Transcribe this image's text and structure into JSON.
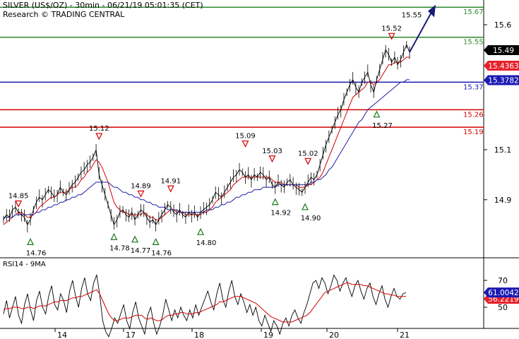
{
  "header": {
    "title": "SILVER (US$/OZ) - 30min - 06/21/19 05:01:35 (CET)",
    "subtitle": "Research © TRADING CENTRAL"
  },
  "rsi_header": "RSI14 - 9MA",
  "colors": {
    "price": "#000000",
    "ma_fast": "#d40000",
    "ma_slow": "#1f1fa8",
    "support_resistance_green": "#2e8b2e",
    "pivot_blue": "#1a1ab5",
    "red_line": "#d40000",
    "arrow": "#1a1a7a",
    "last_price_box": "#000000",
    "ma_box": "#e8202a",
    "pivot_box": "#1a1ab5",
    "rsi": "#000000",
    "rsi_ma": "#d40000"
  },
  "chart_data": [
    {
      "type": "line",
      "name": "price-panel",
      "x_tick_labels": [
        "14",
        "17",
        "18",
        "19",
        "20",
        "21"
      ],
      "y_ticks": [
        14.9,
        15.1,
        15.6
      ],
      "ylim": [
        14.8,
        15.7
      ],
      "horizontal_levels": [
        {
          "value": 15.67,
          "label": "15.67",
          "color": "green"
        },
        {
          "value": 15.55,
          "label": "15.55",
          "color": "green"
        },
        {
          "value": 15.37,
          "label": "15.37",
          "color": "blue"
        },
        {
          "value": 15.26,
          "label": "15.26",
          "color": "red"
        },
        {
          "value": 15.19,
          "label": "15.19",
          "color": "red"
        }
      ],
      "last_price": "15.49",
      "ma_value": "15.4363",
      "pivot_value": "15.3782",
      "highs": [
        {
          "label": "14.85",
          "value": 14.85,
          "bar": 5
        },
        {
          "label": "15.12",
          "value": 15.12,
          "bar": 32
        },
        {
          "label": "14.89",
          "value": 14.89,
          "bar": 46
        },
        {
          "label": "14.91",
          "value": 14.91,
          "bar": 56
        },
        {
          "label": "15.09",
          "value": 15.09,
          "bar": 81
        },
        {
          "label": "15.03",
          "value": 15.03,
          "bar": 90
        },
        {
          "label": "15.02",
          "value": 15.02,
          "bar": 102
        },
        {
          "label": "15.52",
          "value": 15.52,
          "bar": 130
        }
      ],
      "lows": [
        {
          "label": "14.76",
          "value": 14.76,
          "bar": 9
        },
        {
          "label": "14.78",
          "value": 14.78,
          "bar": 37
        },
        {
          "label": "14.77",
          "value": 14.77,
          "bar": 44
        },
        {
          "label": "14.76",
          "value": 14.76,
          "bar": 51
        },
        {
          "label": "14.80",
          "value": 14.8,
          "bar": 66
        },
        {
          "label": "14.92",
          "value": 14.92,
          "bar": 91
        },
        {
          "label": "14.90",
          "value": 14.9,
          "bar": 101
        },
        {
          "label": "15.27",
          "value": 15.27,
          "bar": 125
        }
      ],
      "last_high_label": "15.55",
      "series": [
        {
          "name": "Price",
          "values": [
            14.82,
            14.84,
            14.83,
            14.86,
            14.87,
            14.85,
            14.84,
            14.83,
            14.8,
            14.82,
            14.86,
            14.89,
            14.91,
            14.9,
            14.92,
            14.94,
            14.93,
            14.91,
            14.92,
            14.95,
            14.93,
            14.92,
            14.94,
            14.96,
            14.97,
            14.99,
            15.01,
            15.02,
            15.04,
            15.05,
            15.07,
            15.1,
            15.0,
            14.96,
            14.92,
            14.88,
            14.84,
            14.8,
            14.82,
            14.85,
            14.86,
            14.84,
            14.83,
            14.85,
            14.82,
            14.84,
            14.86,
            14.85,
            14.83,
            14.81,
            14.82,
            14.8,
            14.82,
            14.84,
            14.86,
            14.88,
            14.87,
            14.85,
            14.84,
            14.86,
            14.84,
            14.83,
            14.85,
            14.84,
            14.85,
            14.83,
            14.85,
            14.86,
            14.87,
            14.88,
            14.9,
            14.93,
            14.92,
            14.91,
            14.93,
            14.95,
            14.97,
            14.99,
            15.0,
            15.02,
            15.01,
            14.99,
            15.0,
            14.98,
            15.0,
            14.99,
            15.01,
            15.0,
            14.98,
            14.99,
            14.96,
            14.95,
            14.97,
            14.96,
            14.95,
            14.97,
            14.98,
            14.96,
            14.95,
            14.94,
            14.93,
            14.95,
            14.97,
            14.99,
            14.98,
            15.0,
            15.04,
            15.08,
            15.12,
            15.15,
            15.18,
            15.21,
            15.24,
            15.26,
            15.3,
            15.33,
            15.36,
            15.38,
            15.35,
            15.33,
            15.37,
            15.39,
            15.41,
            15.36,
            15.33,
            15.38,
            15.42,
            15.46,
            15.5,
            15.48,
            15.45,
            15.47,
            15.44,
            15.46,
            15.49,
            15.52,
            15.49
          ]
        },
        {
          "name": "MA fast",
          "values": [
            14.8,
            14.81,
            14.82,
            14.83,
            14.84,
            14.85,
            14.85,
            14.84,
            14.83,
            14.83,
            14.84,
            14.85,
            14.87,
            14.88,
            14.89,
            14.9,
            14.91,
            14.91,
            14.92,
            14.93,
            14.93,
            14.93,
            14.94,
            14.95,
            14.95,
            14.96,
            14.98,
            14.99,
            15.01,
            15.02,
            15.04,
            15.06,
            15.05,
            15.03,
            15.0,
            14.97,
            14.93,
            14.89,
            14.87,
            14.86,
            14.85,
            14.85,
            14.84,
            14.84,
            14.84,
            14.84,
            14.84,
            14.85,
            14.84,
            14.83,
            14.83,
            14.82,
            14.82,
            14.83,
            14.84,
            14.85,
            14.86,
            14.86,
            14.85,
            14.85,
            14.85,
            14.84,
            14.84,
            14.84,
            14.84,
            14.84,
            14.84,
            14.85,
            14.85,
            14.86,
            14.87,
            14.89,
            14.9,
            14.91,
            14.92,
            14.93,
            14.94,
            14.96,
            14.97,
            14.98,
            14.99,
            14.99,
            14.99,
            14.99,
            14.99,
            14.99,
            14.99,
            14.99,
            14.99,
            14.99,
            14.98,
            14.97,
            14.97,
            14.97,
            14.96,
            14.96,
            14.96,
            14.96,
            14.96,
            14.95,
            14.95,
            14.95,
            14.96,
            14.96,
            14.97,
            14.98,
            14.99,
            15.01,
            15.04,
            15.07,
            15.1,
            15.13,
            15.16,
            15.19,
            15.22,
            15.25,
            15.28,
            15.31,
            15.32,
            15.33,
            15.34,
            15.35,
            15.37,
            15.37,
            15.36,
            15.37,
            15.38,
            15.4,
            15.42,
            15.44,
            15.44,
            15.45,
            15.45,
            15.45,
            15.46,
            15.47,
            15.47
          ]
        },
        {
          "name": "MA slow",
          "values": [
            14.83,
            14.83,
            14.83,
            14.83,
            14.84,
            14.84,
            14.84,
            14.84,
            14.84,
            14.84,
            14.84,
            14.85,
            14.85,
            14.86,
            14.86,
            14.87,
            14.87,
            14.88,
            14.88,
            14.89,
            14.89,
            14.9,
            14.9,
            14.91,
            14.91,
            14.92,
            14.92,
            14.93,
            14.94,
            14.95,
            14.96,
            14.97,
            14.97,
            14.97,
            14.97,
            14.97,
            14.96,
            14.95,
            14.95,
            14.94,
            14.93,
            14.93,
            14.92,
            14.92,
            14.91,
            14.91,
            14.9,
            14.9,
            14.89,
            14.89,
            14.88,
            14.88,
            14.87,
            14.87,
            14.87,
            14.86,
            14.86,
            14.86,
            14.86,
            14.85,
            14.85,
            14.85,
            14.85,
            14.85,
            14.85,
            14.85,
            14.85,
            14.85,
            14.86,
            14.86,
            14.86,
            14.87,
            14.87,
            14.88,
            14.88,
            14.89,
            14.89,
            14.9,
            14.91,
            14.91,
            14.92,
            14.92,
            14.93,
            14.93,
            14.94,
            14.94,
            14.94,
            14.95,
            14.95,
            14.95,
            14.95,
            14.95,
            14.96,
            14.96,
            14.96,
            14.96,
            14.96,
            14.96,
            14.96,
            14.96,
            14.96,
            14.96,
            14.96,
            14.97,
            14.97,
            14.98,
            14.98,
            14.99,
            15.0,
            15.02,
            15.03,
            15.05,
            15.07,
            15.09,
            15.11,
            15.13,
            15.15,
            15.17,
            15.19,
            15.21,
            15.22,
            15.24,
            15.26,
            15.27,
            15.28,
            15.29,
            15.3,
            15.31,
            15.32,
            15.33,
            15.34,
            15.35,
            15.36,
            15.37,
            15.37,
            15.38,
            15.38
          ]
        }
      ]
    },
    {
      "type": "line",
      "name": "rsi-panel",
      "y_ticks": [
        50,
        70
      ],
      "ylim": [
        20,
        85
      ],
      "rsi_value": "61.0042",
      "rsi_ma_value": "56.2219",
      "series": [
        {
          "name": "RSI",
          "values": [
            45,
            55,
            42,
            50,
            58,
            44,
            38,
            52,
            60,
            48,
            40,
            55,
            62,
            50,
            45,
            58,
            66,
            52,
            48,
            60,
            55,
            46,
            62,
            70,
            58,
            50,
            64,
            72,
            60,
            55,
            68,
            74,
            60,
            40,
            32,
            28,
            34,
            42,
            38,
            45,
            52,
            40,
            34,
            46,
            54,
            42,
            36,
            30,
            44,
            50,
            38,
            30,
            36,
            44,
            56,
            48,
            40,
            48,
            42,
            50,
            44,
            40,
            48,
            42,
            52,
            44,
            50,
            56,
            62,
            54,
            48,
            60,
            68,
            56,
            50,
            62,
            70,
            58,
            52,
            60,
            54,
            46,
            52,
            44,
            50,
            40,
            36,
            44,
            38,
            32,
            40,
            36,
            30,
            38,
            42,
            36,
            44,
            48,
            42,
            38,
            46,
            52,
            60,
            68,
            70,
            64,
            72,
            68,
            60,
            66,
            74,
            70,
            62,
            68,
            72,
            64,
            58,
            66,
            70,
            62,
            56,
            64,
            68,
            58,
            52,
            60,
            66,
            56,
            50,
            58,
            64,
            58,
            56,
            60,
            61
          ]
        },
        {
          "name": "RSI MA",
          "values": [
            48,
            49,
            49,
            50,
            50,
            50,
            49,
            49,
            50,
            50,
            49,
            50,
            51,
            51,
            51,
            52,
            53,
            54,
            54,
            55,
            55,
            55,
            56,
            57,
            57,
            58,
            58,
            59,
            60,
            61,
            62,
            63,
            60,
            55,
            50,
            45,
            42,
            40,
            40,
            41,
            42,
            42,
            42,
            43,
            44,
            44,
            44,
            42,
            41,
            42,
            41,
            40,
            40,
            41,
            43,
            44,
            44,
            45,
            45,
            46,
            46,
            45,
            45,
            45,
            46,
            46,
            47,
            48,
            49,
            50,
            51,
            52,
            54,
            54,
            55,
            56,
            57,
            58,
            58,
            58,
            57,
            56,
            55,
            54,
            53,
            51,
            49,
            47,
            45,
            43,
            42,
            41,
            40,
            39,
            39,
            39,
            39,
            40,
            41,
            42,
            43,
            44,
            46,
            49,
            52,
            55,
            58,
            61,
            62,
            63,
            64,
            65,
            66,
            67,
            68,
            68,
            67,
            67,
            67,
            67,
            66,
            66,
            65,
            64,
            63,
            62,
            61,
            60,
            60,
            59,
            59,
            58,
            58,
            58,
            58
          ]
        }
      ]
    }
  ]
}
